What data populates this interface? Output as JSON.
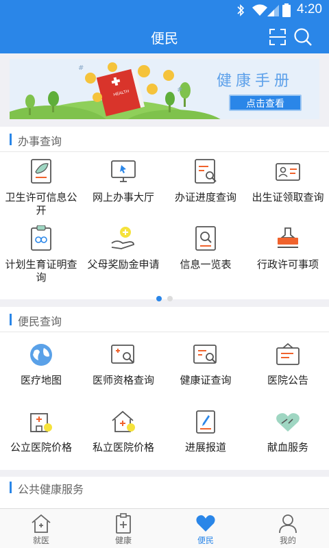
{
  "status_bar": {
    "time": "4:20"
  },
  "header": {
    "title": "便民"
  },
  "banner": {
    "title": "健康手册",
    "button": "点击查看"
  },
  "section1": {
    "title": "办事查询",
    "items": [
      {
        "label": "卫生许可信息公开",
        "icon": "leaf-document-icon"
      },
      {
        "label": "网上办事大厅",
        "icon": "monitor-cursor-icon"
      },
      {
        "label": "办证进度查询",
        "icon": "progress-search-icon"
      },
      {
        "label": "出生证领取查询",
        "icon": "id-card-icon"
      },
      {
        "label": "计划生育证明查询",
        "icon": "family-certificate-icon"
      },
      {
        "label": "父母奖励金申请",
        "icon": "hand-coin-icon"
      },
      {
        "label": "信息一览表",
        "icon": "info-search-icon"
      },
      {
        "label": "行政许可事项",
        "icon": "stamp-icon"
      }
    ],
    "page_dots": 2,
    "active_page": 1
  },
  "section2": {
    "title": "便民查询",
    "items": [
      {
        "label": "医疗地图",
        "icon": "globe-icon"
      },
      {
        "label": "医师资格查询",
        "icon": "doctor-search-icon"
      },
      {
        "label": "健康证查询",
        "icon": "health-cert-search-icon"
      },
      {
        "label": "医院公告",
        "icon": "notice-board-icon"
      },
      {
        "label": "公立医院价格",
        "icon": "hospital-price-icon"
      },
      {
        "label": "私立医院价格",
        "icon": "private-hospital-price-icon"
      },
      {
        "label": "进展报道",
        "icon": "pen-document-icon"
      },
      {
        "label": "献血服务",
        "icon": "heart-hands-icon"
      }
    ]
  },
  "section3": {
    "title": "公共健康服务"
  },
  "tabs": [
    {
      "label": "就医",
      "icon": "home-cross-icon"
    },
    {
      "label": "健康",
      "icon": "clipboard-plus-icon"
    },
    {
      "label": "便民",
      "icon": "heart-icon"
    },
    {
      "label": "我的",
      "icon": "user-icon"
    }
  ],
  "active_tab": 2,
  "colors": {
    "primary": "#2a86e8",
    "accent_orange": "#f0622c",
    "icon_gray": "#555555"
  }
}
